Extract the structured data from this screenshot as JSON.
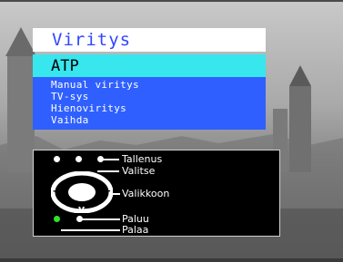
{
  "menu": {
    "title": "Viritys",
    "selected": "ATP",
    "items": [
      {
        "label": "Manual viritys"
      },
      {
        "label": "TV-sys"
      },
      {
        "label": "Hienoviritys"
      },
      {
        "label": "Vaihda"
      }
    ]
  },
  "legend": {
    "tallenus": "Tallenus",
    "valitse": "Valitse",
    "valikkoon": "Valikkoon",
    "paluu": "Paluu",
    "palaa": "Palaa",
    "pad_up": "^",
    "pad_down": "v",
    "pad_left": "–",
    "pad_right": "+"
  },
  "colors": {
    "title_bg": "#ffffff",
    "title_text": "#2f46ff",
    "selected_bg": "#38e6ee",
    "menu_bg": "#2f60ff",
    "legend_bg": "#000000",
    "back_dot": "#2ce52c"
  }
}
